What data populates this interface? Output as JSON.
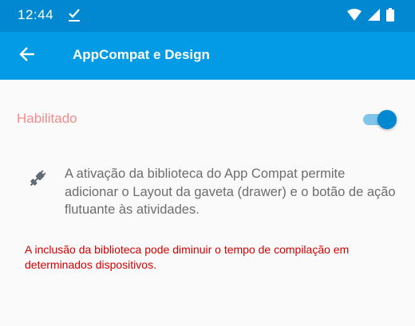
{
  "status_bar": {
    "time": "12:44",
    "background": "#0288d1",
    "icons": [
      "download-done-icon",
      "wifi-icon",
      "signal-icon",
      "battery-icon"
    ]
  },
  "app_bar": {
    "title": "AppCompat e Design",
    "background": "#039be5",
    "back_icon": "arrow-back-icon"
  },
  "setting": {
    "label": "Habilitado",
    "enabled": true,
    "accent": "#0288d1"
  },
  "info": {
    "icon": "plug-icon",
    "text": "A ativação da biblioteca do App Compat permite adicionar o Layout da gaveta (drawer) e o botão de ação flutuante às atividades."
  },
  "warning": {
    "text": "A inclusão da biblioteca pode diminuir o tempo de compilação em determinados dispositivos.",
    "color": "#d50000"
  }
}
